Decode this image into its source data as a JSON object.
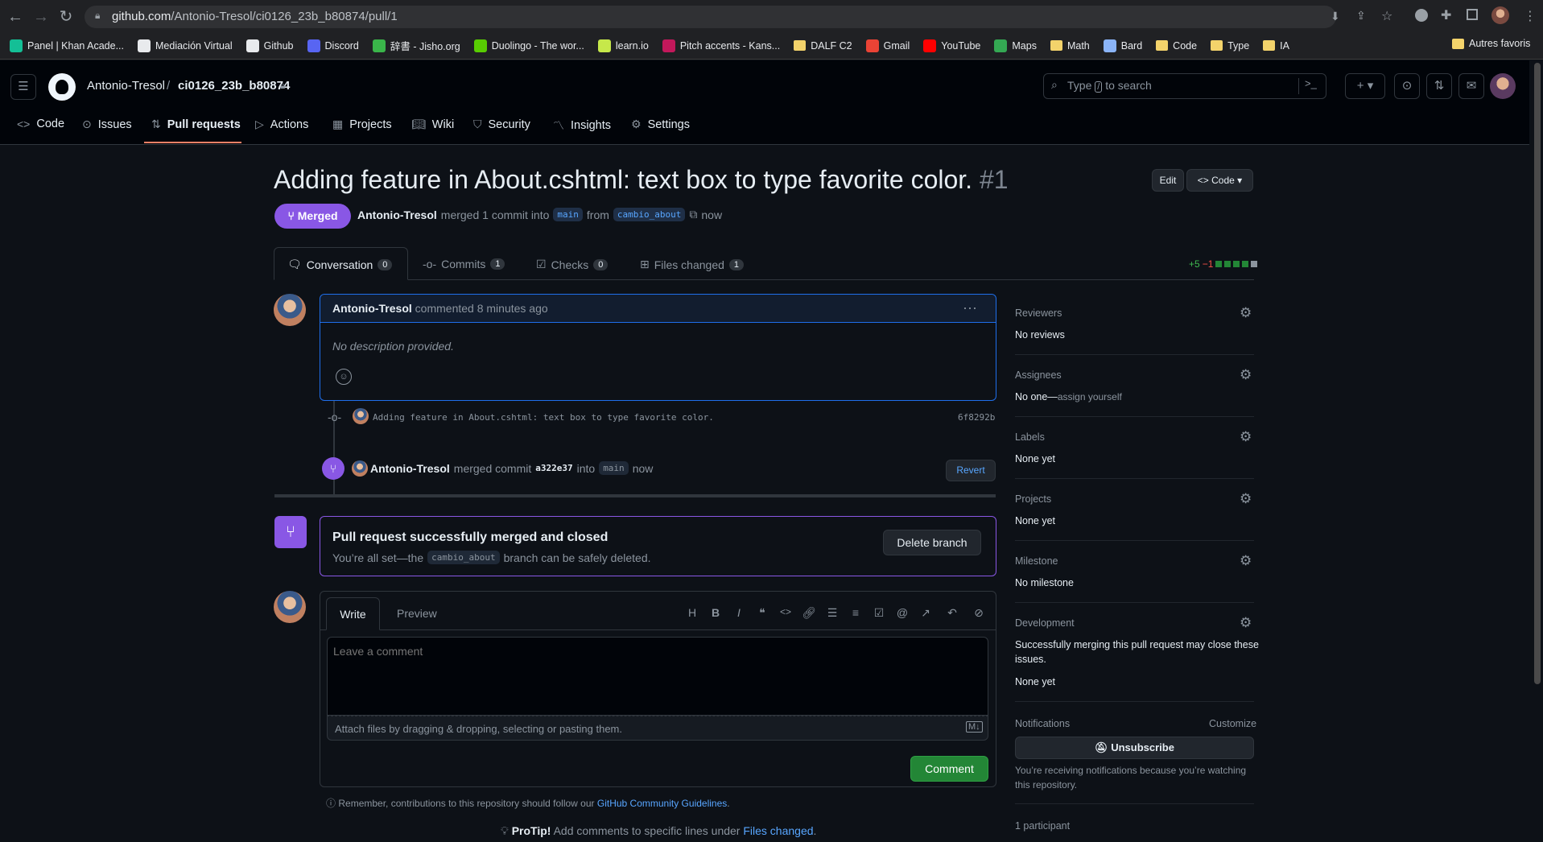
{
  "browser": {
    "url_host": "github.com",
    "url_path": "/Antonio-Tresol/ci0126_23b_b80874/pull/1",
    "bookmarks": [
      {
        "label": "Panel | Khan Acade...",
        "color": "#14bf96"
      },
      {
        "label": "Mediación Virtual",
        "color": "#e8eaed"
      },
      {
        "label": "Github",
        "color": "#e8eaed"
      },
      {
        "label": "Discord",
        "color": "#5865f2"
      },
      {
        "label": "辞書 - Jisho.org",
        "color": "#3ab54a"
      },
      {
        "label": "Duolingo - The wor...",
        "color": "#58cc02"
      },
      {
        "label": "learn.io",
        "color": "#c6e84a"
      },
      {
        "label": "Pitch accents - Kans...",
        "color": "#c2185b"
      },
      {
        "label": "DALF C2",
        "color": "folder"
      },
      {
        "label": "Gmail",
        "color": "#ea4335"
      },
      {
        "label": "YouTube",
        "color": "#ff0000"
      },
      {
        "label": "Maps",
        "color": "#34a853"
      },
      {
        "label": "Math",
        "color": "folder"
      },
      {
        "label": "Bard",
        "color": "#8ab4f8"
      },
      {
        "label": "Code",
        "color": "folder"
      },
      {
        "label": "Type",
        "color": "folder"
      },
      {
        "label": "IA",
        "color": "folder"
      }
    ],
    "other_bookmarks": "Autres favoris"
  },
  "header": {
    "owner": "Antonio-Tresol",
    "separator": "/",
    "repo": "ci0126_23b_b80874",
    "search_placeholder_pre": "Type",
    "search_placeholder_key": "/",
    "search_placeholder_post": "to search"
  },
  "repo_tabs": {
    "code": "Code",
    "issues": "Issues",
    "pull_requests": "Pull requests",
    "actions": "Actions",
    "projects": "Projects",
    "wiki": "Wiki",
    "security": "Security",
    "insights": "Insights",
    "settings": "Settings"
  },
  "pr": {
    "title": "Adding feature in About.cshtml: text box to type favorite color.",
    "number": "#1",
    "edit_label": "Edit",
    "code_label": "Code",
    "status": "Merged",
    "author": "Antonio-Tresol",
    "merged_text": "merged 1 commit into",
    "base_branch": "main",
    "from_text": "from",
    "head_branch": "cambio_about",
    "time": "now"
  },
  "pr_tabs": {
    "conversation": {
      "label": "Conversation",
      "count": "0"
    },
    "commits": {
      "label": "Commits",
      "count": "1"
    },
    "checks": {
      "label": "Checks",
      "count": "0"
    },
    "files": {
      "label": "Files changed",
      "count": "1"
    }
  },
  "diffstat": {
    "additions": "+5",
    "deletions": "−1"
  },
  "comment": {
    "author": "Antonio-Tresol",
    "action": "commented 8 minutes ago",
    "body": "No description provided."
  },
  "commit": {
    "message": "Adding feature in About.cshtml: text box to type favorite color.",
    "sha": "6f8292b"
  },
  "merge_event": {
    "author": "Antonio-Tresol",
    "text": "merged commit",
    "sha": "a322e37",
    "into": "into",
    "branch": "main",
    "time": "now",
    "revert_label": "Revert"
  },
  "merged_box": {
    "title": "Pull request successfully merged and closed",
    "sub_pre": "You’re all set—the",
    "branch": "cambio_about",
    "sub_post": "branch can be safely deleted.",
    "delete_label": "Delete branch"
  },
  "editor": {
    "write_tab": "Write",
    "preview_tab": "Preview",
    "placeholder": "Leave a comment",
    "attach_text": "Attach files by dragging & dropping, selecting or pasting them.",
    "md_label": "M↓",
    "submit_label": "Comment",
    "guidelines_pre": "Remember, contributions to this repository should follow our",
    "guidelines_link": "GitHub Community Guidelines",
    "guidelines_post": "."
  },
  "protip": {
    "bold": "ProTip!",
    "text": "Add comments to specific lines under",
    "link": "Files changed",
    "end": "."
  },
  "sidebar": {
    "reviewers": {
      "label": "Reviewers",
      "value": "No reviews"
    },
    "assignees": {
      "label": "Assignees",
      "value": "No one—",
      "link": "assign yourself"
    },
    "labels": {
      "label": "Labels",
      "value": "None yet"
    },
    "projects": {
      "label": "Projects",
      "value": "None yet"
    },
    "milestone": {
      "label": "Milestone",
      "value": "No milestone"
    },
    "development": {
      "label": "Development",
      "desc_line1": "Successfully merging this pull request may close these",
      "desc_line2": "issues.",
      "value": "None yet"
    },
    "notifications": {
      "label": "Notifications",
      "customize": "Customize",
      "unsubscribe": "Unsubscribe",
      "desc_line1": "You’re receiving notifications because you’re watching",
      "desc_line2": "this repository."
    },
    "participants": "1 participant"
  }
}
